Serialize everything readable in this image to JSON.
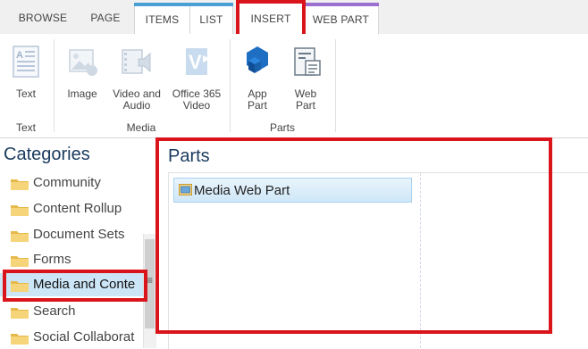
{
  "tabs": {
    "browse": "BROWSE",
    "page": "PAGE",
    "items": "ITEMS",
    "list": "LIST",
    "insert": "INSERT",
    "webpart": "WEB PART"
  },
  "ribbon": {
    "text_button": "Text",
    "image_button": "Image",
    "video_line1": "Video and",
    "video_line2": "Audio",
    "o365_line1": "Office 365",
    "o365_line2": "Video",
    "app_line1": "App",
    "app_line2": "Part",
    "web_line1": "Web",
    "web_line2": "Part",
    "group_text": "Text",
    "group_media": "Media",
    "group_parts": "Parts"
  },
  "categories": {
    "title": "Categories",
    "items": [
      "Community",
      "Content Rollup",
      "Document Sets",
      "Forms",
      "Media and Conte",
      "Search",
      "Social Collaborat"
    ],
    "selected_index": 4
  },
  "parts": {
    "title": "Parts",
    "items": [
      "Media Web Part"
    ]
  },
  "colors": {
    "highlight": "#d9141b",
    "accent": "#1a3a5e",
    "selected_bg": "#cde6f7"
  }
}
